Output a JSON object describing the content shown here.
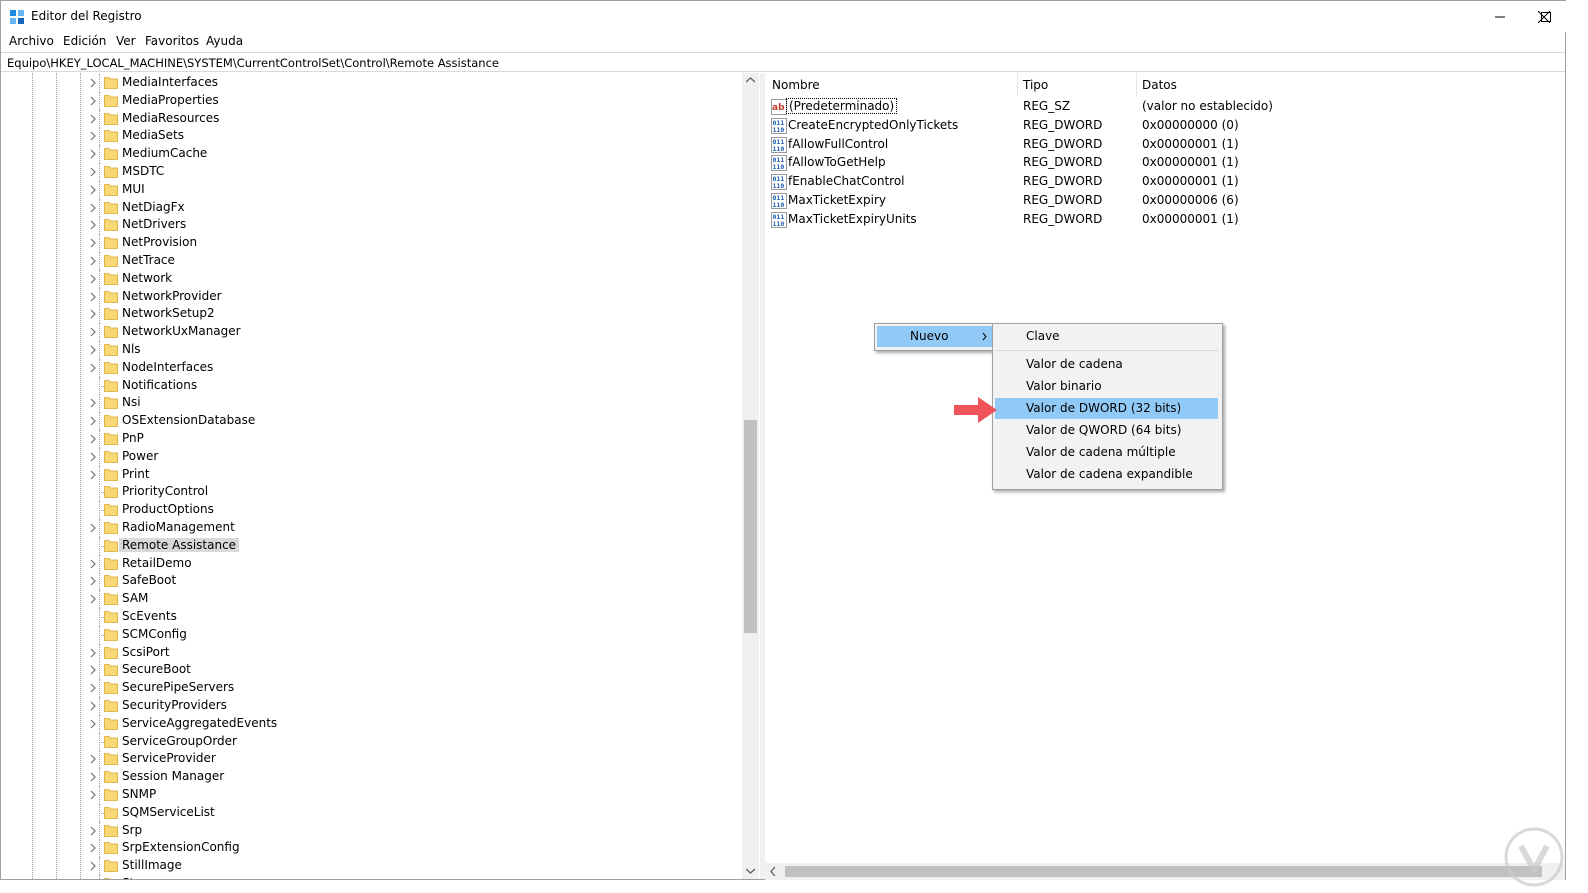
{
  "window": {
    "title": "Editor del Registro",
    "controls": {
      "minimize": "minimize-icon",
      "maximize": "maximize-icon",
      "close": "close-icon"
    }
  },
  "menu": [
    "Archivo",
    "Edición",
    "Ver",
    "Favoritos",
    "Ayuda"
  ],
  "address": "Equipo\\HKEY_LOCAL_MACHINE\\SYSTEM\\CurrentControlSet\\Control\\Remote Assistance",
  "tree": {
    "items": [
      {
        "label": "MediaInterfaces",
        "expandable": true
      },
      {
        "label": "MediaProperties",
        "expandable": true
      },
      {
        "label": "MediaResources",
        "expandable": true
      },
      {
        "label": "MediaSets",
        "expandable": true
      },
      {
        "label": "MediumCache",
        "expandable": true
      },
      {
        "label": "MSDTC",
        "expandable": true
      },
      {
        "label": "MUI",
        "expandable": true
      },
      {
        "label": "NetDiagFx",
        "expandable": true
      },
      {
        "label": "NetDrivers",
        "expandable": true
      },
      {
        "label": "NetProvision",
        "expandable": true
      },
      {
        "label": "NetTrace",
        "expandable": true
      },
      {
        "label": "Network",
        "expandable": true
      },
      {
        "label": "NetworkProvider",
        "expandable": true
      },
      {
        "label": "NetworkSetup2",
        "expandable": true
      },
      {
        "label": "NetworkUxManager",
        "expandable": true
      },
      {
        "label": "Nls",
        "expandable": true
      },
      {
        "label": "NodeInterfaces",
        "expandable": true
      },
      {
        "label": "Notifications",
        "expandable": false
      },
      {
        "label": "Nsi",
        "expandable": true
      },
      {
        "label": "OSExtensionDatabase",
        "expandable": true
      },
      {
        "label": "PnP",
        "expandable": true
      },
      {
        "label": "Power",
        "expandable": true
      },
      {
        "label": "Print",
        "expandable": true
      },
      {
        "label": "PriorityControl",
        "expandable": false
      },
      {
        "label": "ProductOptions",
        "expandable": false
      },
      {
        "label": "RadioManagement",
        "expandable": true
      },
      {
        "label": "Remote Assistance",
        "expandable": false,
        "selected": true
      },
      {
        "label": "RetailDemo",
        "expandable": true
      },
      {
        "label": "SafeBoot",
        "expandable": true
      },
      {
        "label": "SAM",
        "expandable": true
      },
      {
        "label": "ScEvents",
        "expandable": false
      },
      {
        "label": "SCMConfig",
        "expandable": false
      },
      {
        "label": "ScsiPort",
        "expandable": true
      },
      {
        "label": "SecureBoot",
        "expandable": true
      },
      {
        "label": "SecurePipeServers",
        "expandable": true
      },
      {
        "label": "SecurityProviders",
        "expandable": true
      },
      {
        "label": "ServiceAggregatedEvents",
        "expandable": true
      },
      {
        "label": "ServiceGroupOrder",
        "expandable": false
      },
      {
        "label": "ServiceProvider",
        "expandable": true
      },
      {
        "label": "Session Manager",
        "expandable": true
      },
      {
        "label": "SNMP",
        "expandable": true
      },
      {
        "label": "SQMServiceList",
        "expandable": false
      },
      {
        "label": "Srp",
        "expandable": true
      },
      {
        "label": "SrpExtensionConfig",
        "expandable": true
      },
      {
        "label": "StillImage",
        "expandable": true
      },
      {
        "label": "St",
        "expandable": true
      }
    ]
  },
  "list": {
    "columns": [
      "Nombre",
      "Tipo",
      "Datos"
    ],
    "rows": [
      {
        "name": "(Predeterminado)",
        "type": "REG_SZ",
        "data": "(valor no establecido)",
        "icon": "string-value-icon"
      },
      {
        "name": "CreateEncryptedOnlyTickets",
        "type": "REG_DWORD",
        "data": "0x00000000 (0)",
        "icon": "binary-value-icon"
      },
      {
        "name": "fAllowFullControl",
        "type": "REG_DWORD",
        "data": "0x00000001 (1)",
        "icon": "binary-value-icon"
      },
      {
        "name": "fAllowToGetHelp",
        "type": "REG_DWORD",
        "data": "0x00000001 (1)",
        "icon": "binary-value-icon"
      },
      {
        "name": "fEnableChatControl",
        "type": "REG_DWORD",
        "data": "0x00000001 (1)",
        "icon": "binary-value-icon"
      },
      {
        "name": "MaxTicketExpiry",
        "type": "REG_DWORD",
        "data": "0x00000006 (6)",
        "icon": "binary-value-icon"
      },
      {
        "name": "MaxTicketExpiryUnits",
        "type": "REG_DWORD",
        "data": "0x00000001 (1)",
        "icon": "binary-value-icon"
      }
    ]
  },
  "context_menu": {
    "parent_item": "Nuevo",
    "submenu": [
      "Clave",
      "Valor de cadena",
      "Valor binario",
      "Valor de DWORD (32 bits)",
      "Valor de QWORD (64 bits)",
      "Valor de cadena múltiple",
      "Valor de cadena expandible"
    ],
    "highlighted": "Valor de DWORD (32 bits)"
  },
  "colors": {
    "highlight": "#91c9f7",
    "selection": "#d9d9d9",
    "arrow": "#f0545b",
    "folder": "#f8d775"
  }
}
